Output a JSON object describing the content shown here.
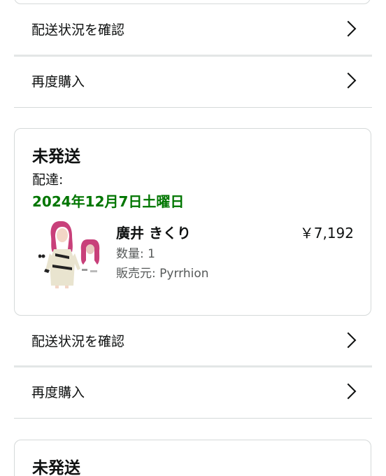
{
  "rows_top": {
    "track_label": "配送状況を確認",
    "rebuy_label": "再度購入"
  },
  "order": {
    "status": "未発送",
    "delivery_label": "配達:",
    "delivery_date": "2024年12月7日土曜日",
    "item": {
      "name": "廣井 きくり",
      "price": "￥7,192",
      "quantity": "数量: 1",
      "seller": "販売元: Pyrrhion",
      "image_icon": "cosplay-costume-product-image"
    }
  },
  "rows_mid": {
    "track_label": "配送状況を確認",
    "rebuy_label": "再度購入"
  },
  "next_order": {
    "status": "未発送"
  },
  "colors": {
    "delivery_green": "#007600",
    "divider": "#d5d9d9",
    "muted_text": "#565959"
  },
  "icons": {
    "chevron": "chevron-right-icon"
  }
}
